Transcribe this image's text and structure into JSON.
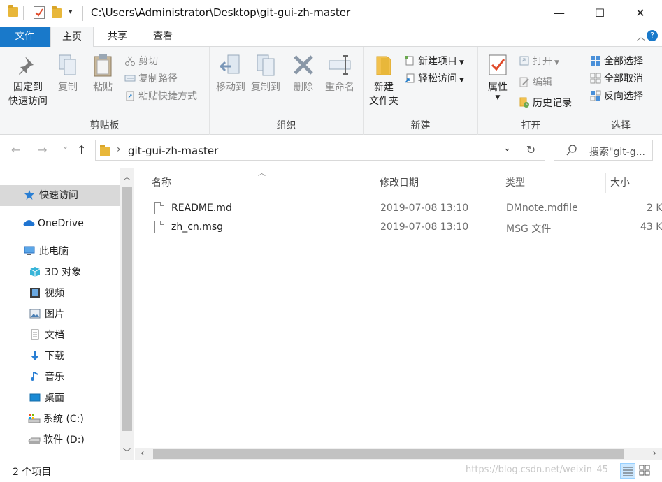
{
  "window": {
    "title": "C:\\Users\\Administrator\\Desktop\\git-gui-zh-master",
    "minimize": "—",
    "maximize": "☐",
    "close": "✕",
    "qa_dropdown": "▾"
  },
  "tabs": {
    "file": "文件",
    "home": "主页",
    "share": "共享",
    "view": "查看",
    "collapse": "︿",
    "help": "?"
  },
  "ribbon": {
    "clipboard": {
      "label": "剪贴板",
      "pin": "固定到\n快速访问",
      "copy": "复制",
      "paste": "粘贴",
      "cut": "剪切",
      "copy_path": "复制路径",
      "paste_shortcut": "粘贴快捷方式"
    },
    "organize": {
      "label": "组织",
      "move_to": "移动到",
      "copy_to": "复制到",
      "delete": "删除",
      "rename": "重命名"
    },
    "new": {
      "label": "新建",
      "new_folder": "新建\n文件夹",
      "new_item": "新建项目",
      "easy_access": "轻松访问"
    },
    "open": {
      "label": "打开",
      "properties": "属性",
      "open": "打开",
      "edit": "编辑",
      "history": "历史记录"
    },
    "select": {
      "label": "选择",
      "select_all": "全部选择",
      "select_none": "全部取消",
      "invert": "反向选择"
    }
  },
  "navbar": {
    "back": "←",
    "forward": "→",
    "recent": "⌄",
    "up": "↑",
    "address": "git-gui-zh-master",
    "address_sep": "›",
    "address_dropdown": "⌄",
    "refresh": "↻",
    "search_placeholder": "搜索\"git-g..."
  },
  "navpane": {
    "items": [
      {
        "label": "快速访问",
        "icon": "star-icon"
      },
      {
        "label": "OneDrive",
        "icon": "cloud-icon"
      },
      {
        "label": "此电脑",
        "icon": "computer-icon"
      },
      {
        "label": "3D 对象",
        "icon": "cube-icon"
      },
      {
        "label": "视频",
        "icon": "video-icon"
      },
      {
        "label": "图片",
        "icon": "picture-icon"
      },
      {
        "label": "文档",
        "icon": "document-icon"
      },
      {
        "label": "下载",
        "icon": "download-icon"
      },
      {
        "label": "音乐",
        "icon": "music-icon"
      },
      {
        "label": "桌面",
        "icon": "desktop-icon"
      },
      {
        "label": "系统 (C:)",
        "icon": "drive-c-icon"
      },
      {
        "label": "软件 (D:)",
        "icon": "drive-d-icon"
      }
    ],
    "scroll_up": "︿",
    "scroll_down": "﹀"
  },
  "filelist": {
    "columns": {
      "name": "名称",
      "date": "修改日期",
      "type": "类型",
      "size": "大小"
    },
    "sort_indicator": "︿",
    "rows": [
      {
        "name": "README.md",
        "date": "2019-07-08 13:10",
        "type": "DMnote.mdfile",
        "size": "2 K"
      },
      {
        "name": "zh_cn.msg",
        "date": "2019-07-08 13:10",
        "type": "MSG 文件",
        "size": "43 K"
      }
    ],
    "hscroll_left": "‹",
    "hscroll_right": "›"
  },
  "statusbar": {
    "count": "2 个项目",
    "watermark": "https://blog.csdn.net/weixin_45"
  },
  "colors": {
    "accent": "#1979ca",
    "ribbon_bg": "#f5f6f7",
    "selected_nav": "#d9d9d9"
  }
}
